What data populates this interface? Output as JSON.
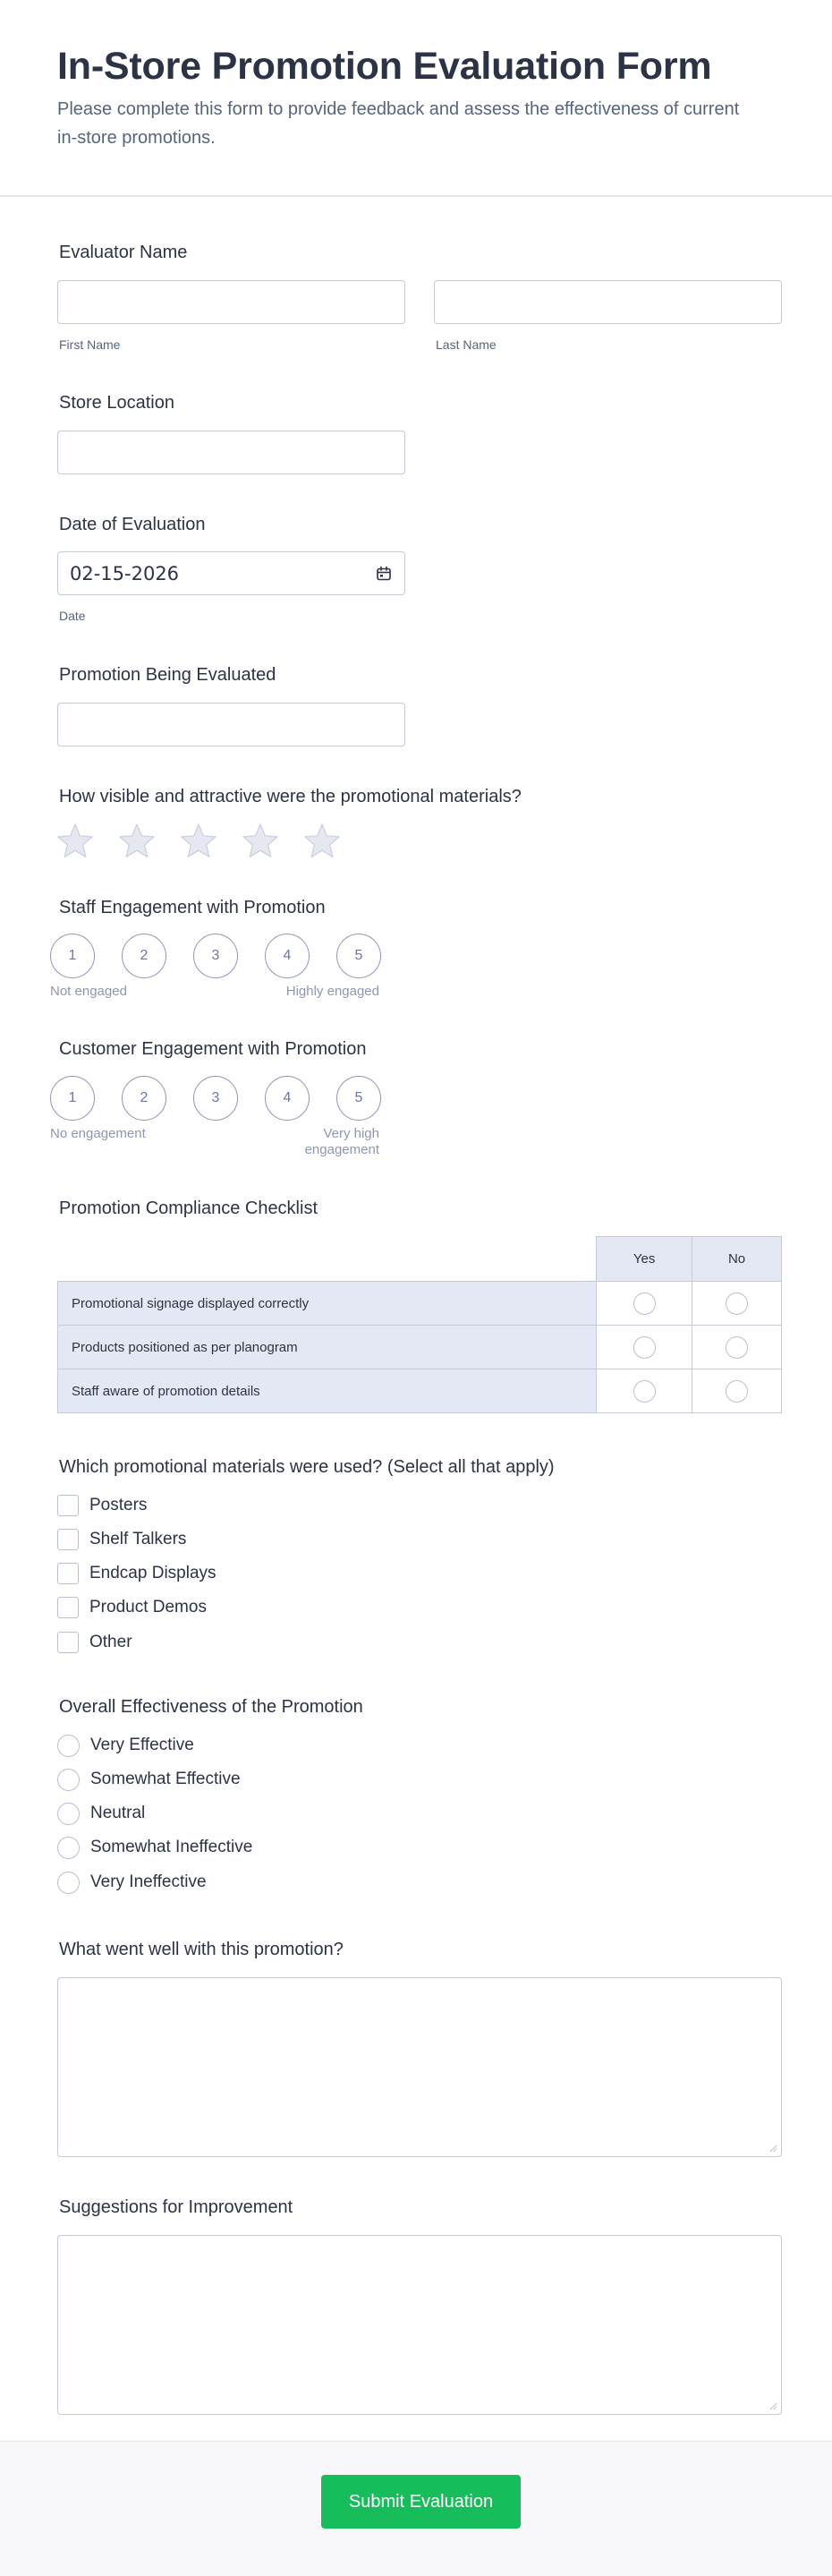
{
  "header": {
    "title": "In-Store Promotion Evaluation Form",
    "subtitle": "Please complete this form to provide feedback and assess the effectiveness of current in-store promotions."
  },
  "evaluator": {
    "label": "Evaluator Name",
    "first_name": {
      "value": "",
      "sublabel": "First Name"
    },
    "last_name": {
      "value": "",
      "sublabel": "Last Name"
    }
  },
  "store_location": {
    "label": "Store Location",
    "value": ""
  },
  "date": {
    "label": "Date of Evaluation",
    "value": "02-15-2026",
    "sublabel": "Date",
    "icon": "calendar-icon"
  },
  "promotion": {
    "label": "Promotion Being Evaluated",
    "value": ""
  },
  "visibility_rating": {
    "label": "How visible and attractive were the promotional materials?",
    "max_stars": 5,
    "selected": 0,
    "icon": "star-icon"
  },
  "staff_engagement": {
    "label": "Staff Engagement with Promotion",
    "options": [
      "1",
      "2",
      "3",
      "4",
      "5"
    ],
    "low_label": "Not engaged",
    "high_label": "Highly engaged"
  },
  "customer_engagement": {
    "label": "Customer Engagement with Promotion",
    "options": [
      "1",
      "2",
      "3",
      "4",
      "5"
    ],
    "low_label": "No engagement",
    "high_label": "Very high engagement"
  },
  "compliance": {
    "label": "Promotion Compliance Checklist",
    "columns": [
      "Yes",
      "No"
    ],
    "rows": [
      "Promotional signage displayed correctly",
      "Products positioned as per planogram",
      "Staff aware of promotion details"
    ]
  },
  "materials": {
    "label": "Which promotional materials were used? (Select all that apply)",
    "options": [
      "Posters",
      "Shelf Talkers",
      "Endcap Displays",
      "Product Demos",
      "Other"
    ]
  },
  "effectiveness": {
    "label": "Overall Effectiveness of the Promotion",
    "options": [
      "Very Effective",
      "Somewhat Effective",
      "Neutral",
      "Somewhat Ineffective",
      "Very Ineffective"
    ]
  },
  "went_well": {
    "label": "What went well with this promotion?",
    "value": ""
  },
  "suggestions": {
    "label": "Suggestions for Improvement",
    "value": ""
  },
  "submit": {
    "label": "Submit Evaluation"
  },
  "colors": {
    "accent": "#18bd5b",
    "text": "#2c3345",
    "muted": "#57647e",
    "border": "#c3cad8",
    "matrix_bg": "#e4e8f4"
  }
}
